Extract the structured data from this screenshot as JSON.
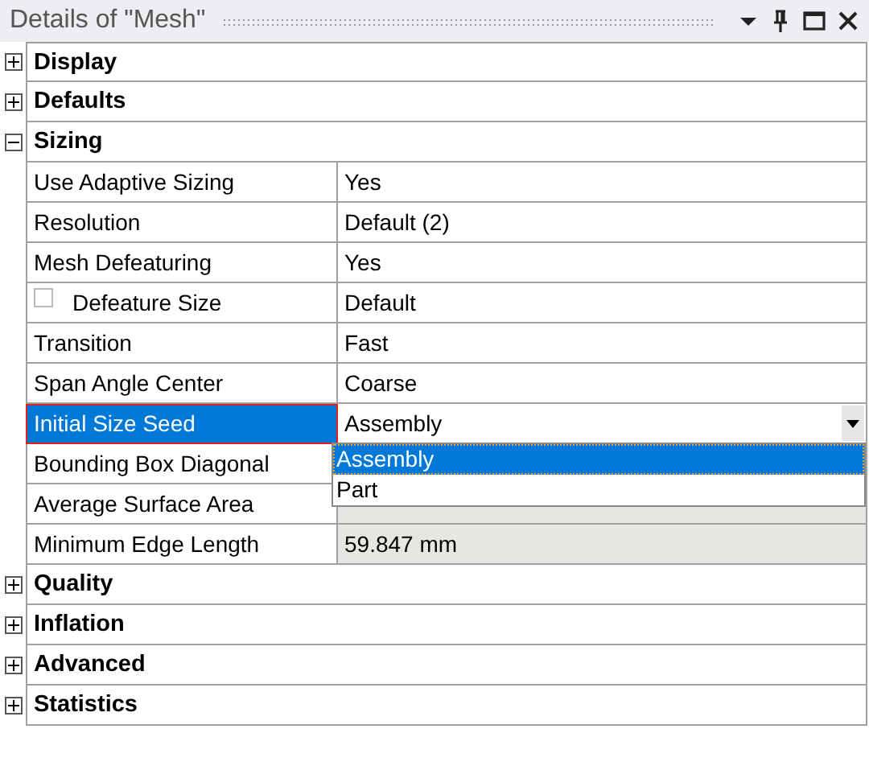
{
  "panel": {
    "title": "Details of \"Mesh\""
  },
  "groups": [
    {
      "label": "Display",
      "expanded": false
    },
    {
      "label": "Defaults",
      "expanded": false
    },
    {
      "label": "Sizing",
      "expanded": true,
      "properties": [
        {
          "kind": "text",
          "name": "Use Adaptive Sizing",
          "value": "Yes",
          "selected": false,
          "read_only": false
        },
        {
          "kind": "text",
          "name": "Resolution",
          "value": "Default (2)",
          "selected": false,
          "read_only": false
        },
        {
          "kind": "text",
          "name": "Mesh Defeaturing",
          "value": "Yes",
          "selected": false,
          "read_only": false
        },
        {
          "kind": "checkbox",
          "name": "Defeature Size",
          "value": "Default",
          "checked": false,
          "selected": false,
          "read_only": false
        },
        {
          "kind": "text",
          "name": "Transition",
          "value": "Fast",
          "selected": false,
          "read_only": false
        },
        {
          "kind": "text",
          "name": "Span Angle Center",
          "value": "Coarse",
          "selected": false,
          "read_only": false
        },
        {
          "kind": "dropdown",
          "name": "Initial Size Seed",
          "value": "Assembly",
          "selected": true,
          "read_only": false,
          "options": [
            {
              "label": "Assembly",
              "selected": true
            },
            {
              "label": "Part",
              "selected": false
            }
          ]
        },
        {
          "kind": "text",
          "name": "Bounding Box Diagonal",
          "selected": false
        },
        {
          "kind": "text",
          "name": "Average Surface Area",
          "selected": false,
          "read_only": true
        },
        {
          "kind": "text",
          "name": "Minimum Edge Length",
          "value": "59.847 mm",
          "selected": false,
          "read_only": true
        }
      ]
    },
    {
      "label": "Quality",
      "expanded": false
    },
    {
      "label": "Inflation",
      "expanded": false
    },
    {
      "label": "Advanced",
      "expanded": false
    },
    {
      "label": "Statistics",
      "expanded": false
    }
  ]
}
